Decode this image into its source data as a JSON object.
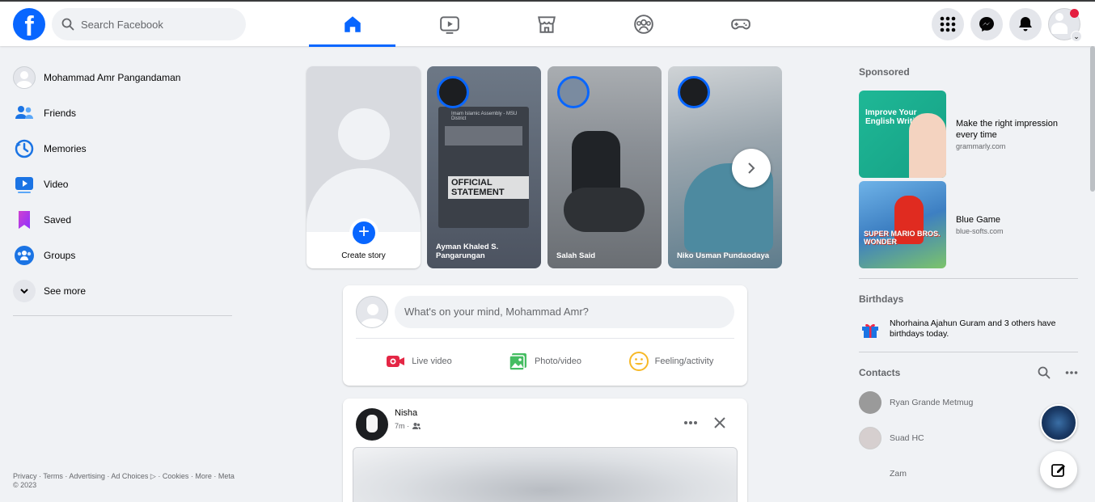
{
  "header": {
    "logo": "f",
    "search_placeholder": "Search Facebook",
    "nav_tabs": [
      {
        "name": "home",
        "icon": "home-icon",
        "active": true
      },
      {
        "name": "watch",
        "icon": "video-play-icon",
        "active": false
      },
      {
        "name": "marketplace",
        "icon": "store-icon",
        "active": false
      },
      {
        "name": "groups",
        "icon": "groups-icon",
        "active": false
      },
      {
        "name": "gaming",
        "icon": "gamepad-icon",
        "active": false
      }
    ],
    "right_buttons": [
      "menu-grid-icon",
      "messenger-icon",
      "bell-icon",
      "profile-avatar"
    ]
  },
  "sidebar": {
    "items": [
      {
        "label": "Mohammad Amr Pangandaman",
        "icon": "profile-avatar"
      },
      {
        "label": "Friends",
        "icon": "friends-icon"
      },
      {
        "label": "Memories",
        "icon": "clock-icon"
      },
      {
        "label": "Video",
        "icon": "video-icon"
      },
      {
        "label": "Saved",
        "icon": "bookmark-icon"
      },
      {
        "label": "Groups",
        "icon": "groups-icon"
      },
      {
        "label": "See more",
        "icon": "chevron-down-icon"
      }
    ],
    "footer": "Privacy · Terms · Advertising · Ad Choices",
    "footer2": " · Cookies · More · Meta © 2023"
  },
  "stories": {
    "create_label": "Create story",
    "items": [
      {
        "name": "Ayman Khaled S. Pangarungan",
        "card_header": "Imam Islamic Assembly - MSU District",
        "card_title": "OFFICIAL STATEMENT"
      },
      {
        "name": "Salah Said"
      },
      {
        "name": "Niko Usman Pundaodaya"
      }
    ]
  },
  "composer": {
    "placeholder": "What's on your mind, Mohammad Amr?",
    "actions": [
      "Live video",
      "Photo/video",
      "Feeling/activity"
    ]
  },
  "post": {
    "author": "Nisha",
    "time": "7m ·"
  },
  "right": {
    "sponsored_label": "Sponsored",
    "ads": [
      {
        "title": "Make the right impression every time",
        "url": "grammarly.com",
        "image_text": "Improve Your English Writing"
      },
      {
        "title": "Blue Game",
        "url": "blue-softs.com",
        "image_text": "SUPER MARIO BROS. WONDER"
      }
    ],
    "birthdays_label": "Birthdays",
    "birthday_text": "Nhorhaina Ajahun Guram and 3 others have birthdays today.",
    "contacts_label": "Contacts",
    "contacts": [
      {
        "name": "Ryan Grande Metmug",
        "color": "#9a9a9a"
      },
      {
        "name": "Suad HC",
        "color": "#d6cfcf"
      },
      {
        "name": "Zam",
        "color": "#ffffff"
      }
    ]
  },
  "colors": {
    "brand": "#0866ff",
    "background": "#f0f2f5",
    "live_red": "#e42645",
    "photo_green": "#45bd62",
    "feeling_yellow": "#f7b928"
  }
}
